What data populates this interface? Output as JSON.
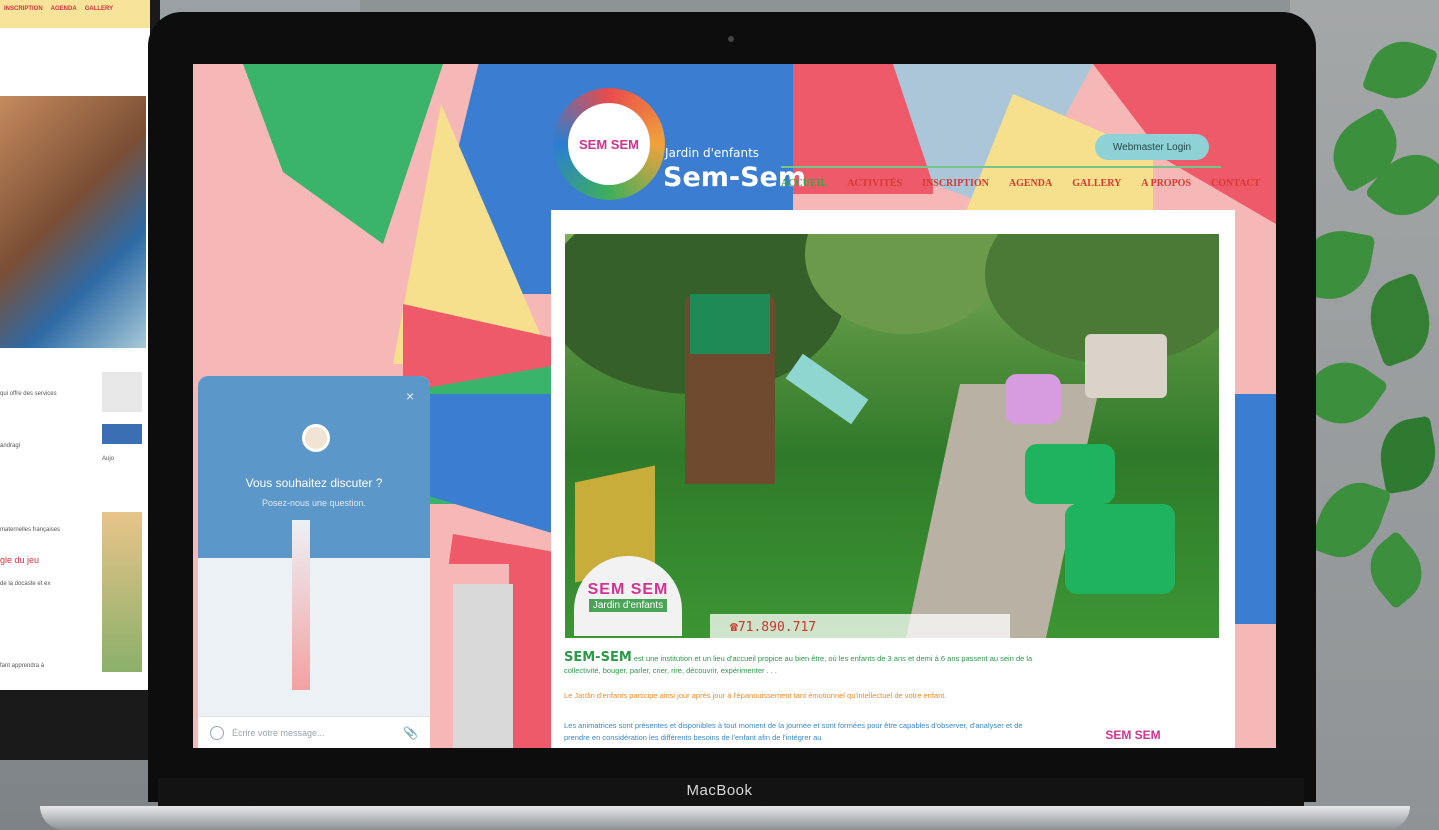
{
  "back_site": {
    "nav_items": [
      "INSCRIPTION",
      "AGENDA",
      "GALLERY"
    ],
    "snippets": [
      "qui offre des services",
      "andragi",
      "maternelles françaises",
      "gle du jeu",
      "de la docaste et ex",
      "fant apprendra à"
    ],
    "side_label": "Aujo"
  },
  "site": {
    "logo_text": "SEM SEM",
    "logo_sub": "Jardin d'enfants",
    "title": "Sem-Sem",
    "login_label": "Webmaster Login",
    "nav": [
      "ACCUEIL",
      "ACTIVITÉS",
      "INSCRIPTION",
      "AGENDA",
      "GALLERY",
      "A PROPOS",
      "CONTACT"
    ],
    "photo_logo_title": "SEM SEM",
    "photo_logo_sub": "Jardin d'enfants",
    "phone": "☎71.890.717",
    "desc_lead": "SEM-SEM",
    "desc_1": "est une institution et un lieu d'accueil propice au bien être, où les enfants de 3 ans et demi à 6 ans passent au sein de la collectivité, bouger, parler, crier, rire, découvrir, expérimenter . . .",
    "desc_2": "Le Jardin d'enfants participe ainsi jour après jour à l'épanouissement tant émotionnel qu'intellectuel de votre enfant.",
    "desc_3": "Les animatrices sont présentes et disponibles à tout moment de la journée et sont formées pour être capables d'observer, d'analyser et de prendre en considération les différents besoins de l'enfant afin de l'intégrer au",
    "bottom_logo": "SEM SEM"
  },
  "chat": {
    "close": "×",
    "title": "Vous souhaitez discuter ?",
    "subtitle": "Posez-nous une question.",
    "input_placeholder": "Écrire votre message..."
  },
  "device": {
    "brand": "MacBook"
  }
}
